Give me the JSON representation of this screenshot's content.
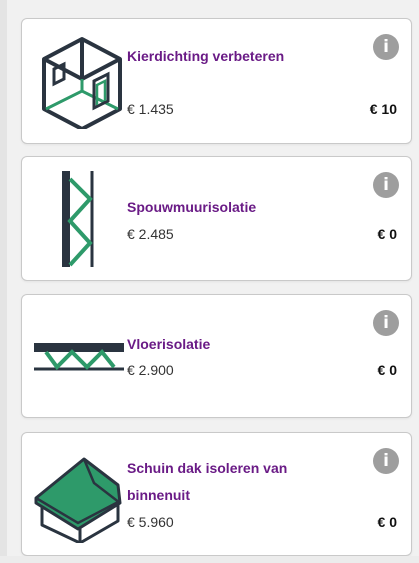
{
  "measures": [
    {
      "icon": "house-airtightness-icon",
      "title": "Kierdichting verbeteren",
      "price": "€ 1.435",
      "value": "€ 10",
      "info": "i"
    },
    {
      "icon": "cavity-wall-icon",
      "title": "Spouwmuurisolatie",
      "price": "€ 2.485",
      "value": "€ 0",
      "info": "i"
    },
    {
      "icon": "floor-insulation-icon",
      "title": "Vloerisolatie",
      "price": "€ 2.900",
      "value": "€ 0",
      "info": "i"
    },
    {
      "icon": "pitched-roof-icon",
      "title": "Schuin dak isoleren van binnenuit",
      "price": "€ 5.960",
      "value": "€ 0",
      "info": "i"
    }
  ],
  "colors": {
    "accent": "#6a1b86",
    "icon_green": "#2e9a6a",
    "icon_dark": "#2a3440",
    "info_grey": "#9e9e9e"
  }
}
